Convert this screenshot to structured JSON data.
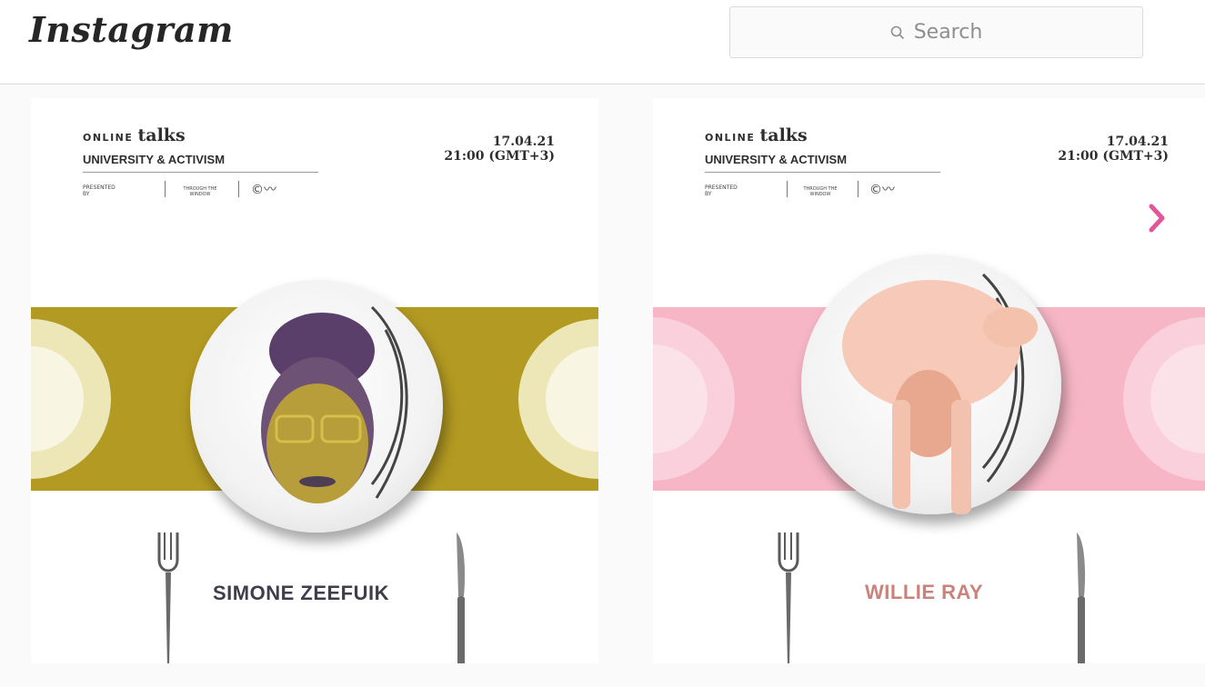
{
  "app": {
    "logo": "Instagram"
  },
  "search": {
    "placeholder": "Search",
    "icon": "search-icon"
  },
  "posts": [
    {
      "series_small": "ONLINE",
      "series_big": "talks",
      "subtitle": "UNIVERSITY & ACTIVISM",
      "presented_by": "PRESENTED BY",
      "partner": "THROUGH THE WINDOW",
      "date": "17.04.21",
      "time": "21:00 (GMT+3)",
      "speaker": "SIMONE ZEEFUIK",
      "accent_color": "#b39a22"
    },
    {
      "series_small": "ONLINE",
      "series_big": "talks",
      "subtitle": "UNIVERSITY & ACTIVISM",
      "presented_by": "PRESENTED BY",
      "partner": "THROUGH THE WINDOW",
      "date": "17.04.21",
      "time": "21:00 (GMT+3)",
      "speaker": "WILLIE RAY",
      "accent_color": "#f6b6c6"
    }
  ],
  "carousel": {
    "next_icon": "chevron-right-icon",
    "color": "#e0579b"
  }
}
